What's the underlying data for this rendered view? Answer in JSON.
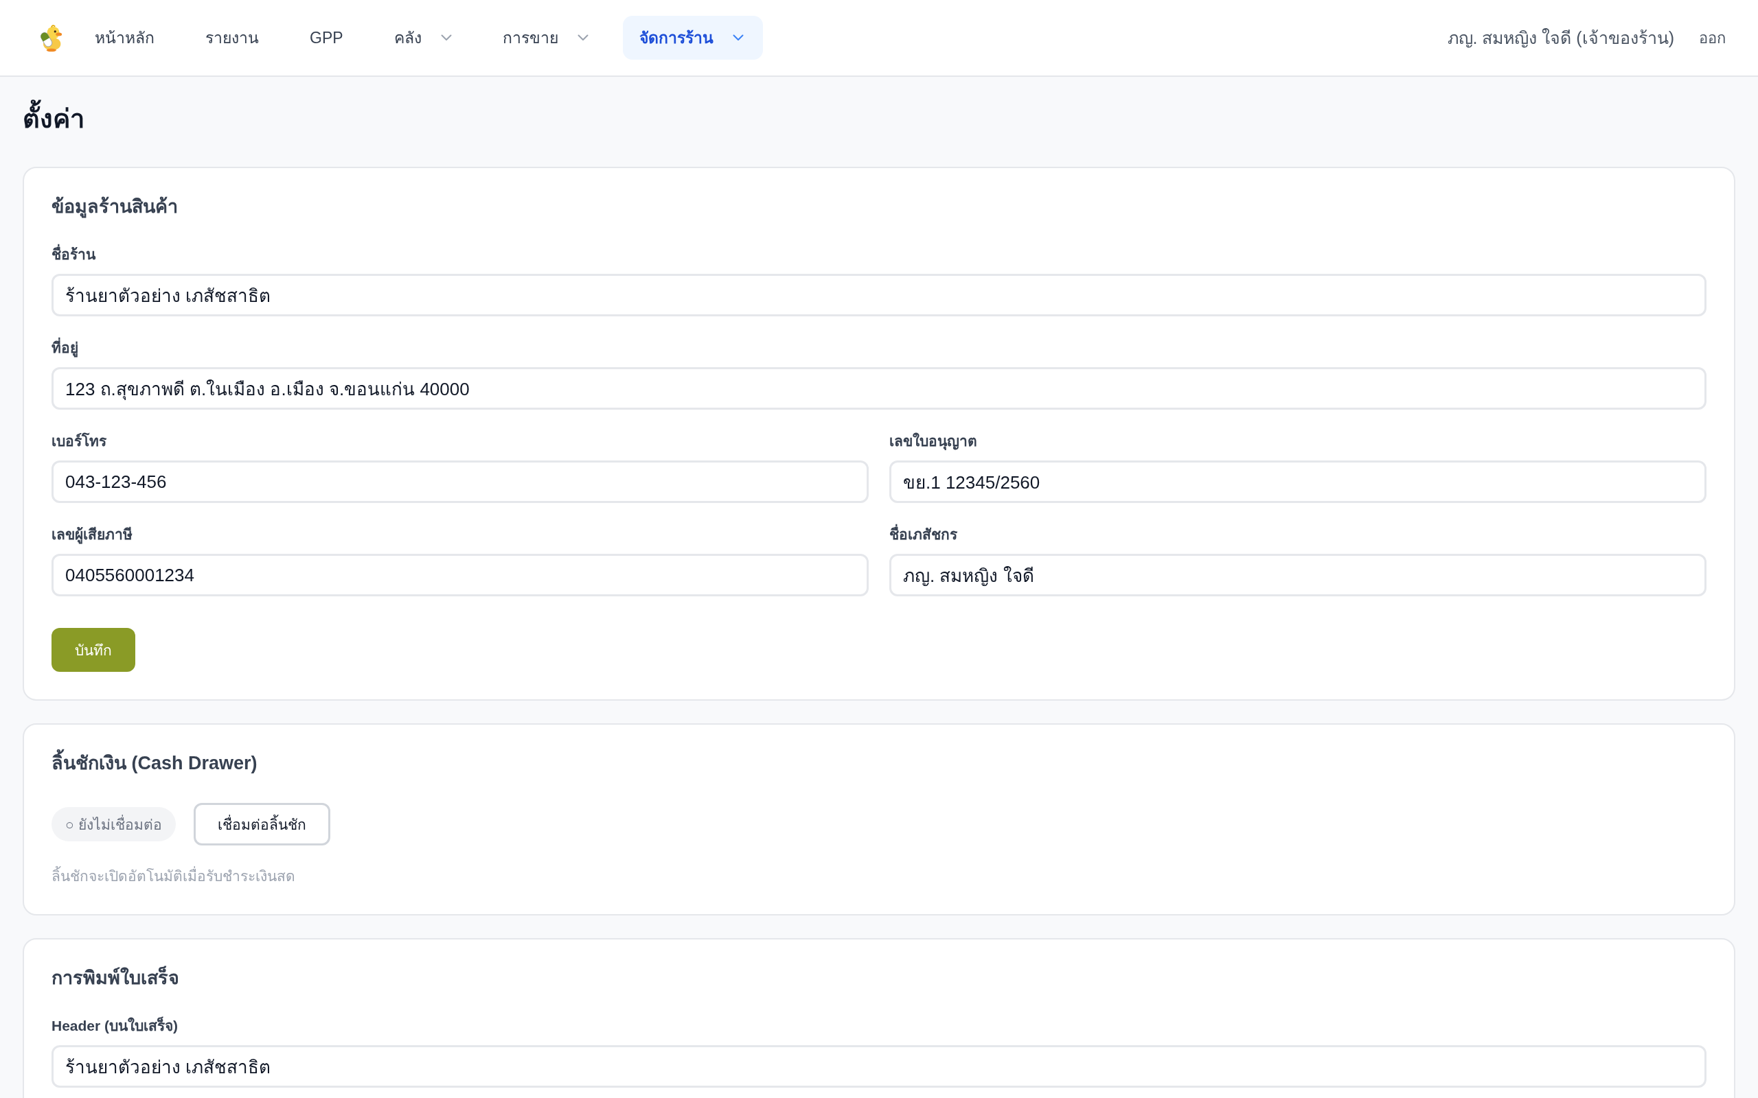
{
  "nav": {
    "items": [
      {
        "label": "หน้าหลัก",
        "selected": false,
        "has_menu": false
      },
      {
        "label": "รายงาน",
        "selected": false,
        "has_menu": false
      },
      {
        "label": "GPP",
        "selected": false,
        "has_menu": false
      },
      {
        "label": "คลัง",
        "selected": false,
        "has_menu": true
      },
      {
        "label": "การขาย",
        "selected": false,
        "has_menu": true
      },
      {
        "label": "จัดการร้าน",
        "selected": true,
        "has_menu": true
      }
    ],
    "user": "ภญ. สมหญิง ใจดี (เจ้าของร้าน)",
    "logout": "ออก"
  },
  "page_title": "ตั้งค่า",
  "sections": [
    {
      "kind": "form",
      "title": "ข้อมูลร้านสินค้า",
      "rows": [
        [
          {
            "label": "ชื่อร้าน",
            "value": "ร้านยาตัวอย่าง เภสัชสาธิต"
          }
        ],
        [
          {
            "label": "ที่อยู่",
            "value": "123 ถ.สุขภาพดี ต.ในเมือง อ.เมือง จ.ขอนแก่น 40000"
          }
        ],
        [
          {
            "label": "เบอร์โทร",
            "value": "043-123-456"
          },
          {
            "label": "เลขใบอนุญาต",
            "value": "ขย.1 12345/2560"
          }
        ],
        [
          {
            "label": "เลขผู้เสียภาษี",
            "value": "0405560001234"
          },
          {
            "label": "ชื่อเภสัชกร",
            "value": "ภญ. สมหญิง ใจดี"
          }
        ]
      ],
      "save_button": "บันทึก"
    },
    {
      "kind": "device",
      "title": "ลิ้นชักเงิน (Cash Drawer)",
      "status": {
        "label": "○ ยังไม่เชื่อมต่อ",
        "connected": false
      },
      "button": "เชื่อมต่อลิ้นชัก",
      "hint": "ลิ้นชักจะเปิดอัตโนมัติเมื่อรับชำระเงินสด"
    },
    {
      "kind": "form",
      "title": "การพิมพ์ใบเสร็จ",
      "rows": [
        [
          {
            "label": "Header (บนใบเสร็จ)",
            "value": "ร้านยาตัวอย่าง เภสัชสาธิต"
          }
        ]
      ]
    }
  ]
}
